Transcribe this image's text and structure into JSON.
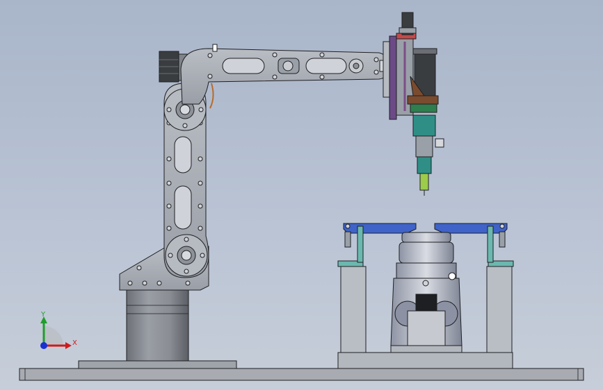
{
  "triad": {
    "x_label": "X",
    "y_label": "Y"
  },
  "colors": {
    "background_top": "#a9b5c9",
    "background_bottom": "#c7ced9",
    "metal": "#a9adb4",
    "metal_dark": "#5f6369",
    "outline": "#1e1f22",
    "fixture_blue": "#3f63c8",
    "fixture_teal": "#6bb8b0",
    "motor_dark": "#3a3d40",
    "tool_teal": "#2f8f86",
    "tool_green": "#9ccc4a",
    "bracket_brown": "#7a4b2e",
    "plate_purple": "#6b4a86",
    "axis_x": "#d11a1a",
    "axis_y": "#1e9e2a",
    "axis_z": "#1a2fd1"
  },
  "icons": [
    "coordinate-triad-icon"
  ]
}
